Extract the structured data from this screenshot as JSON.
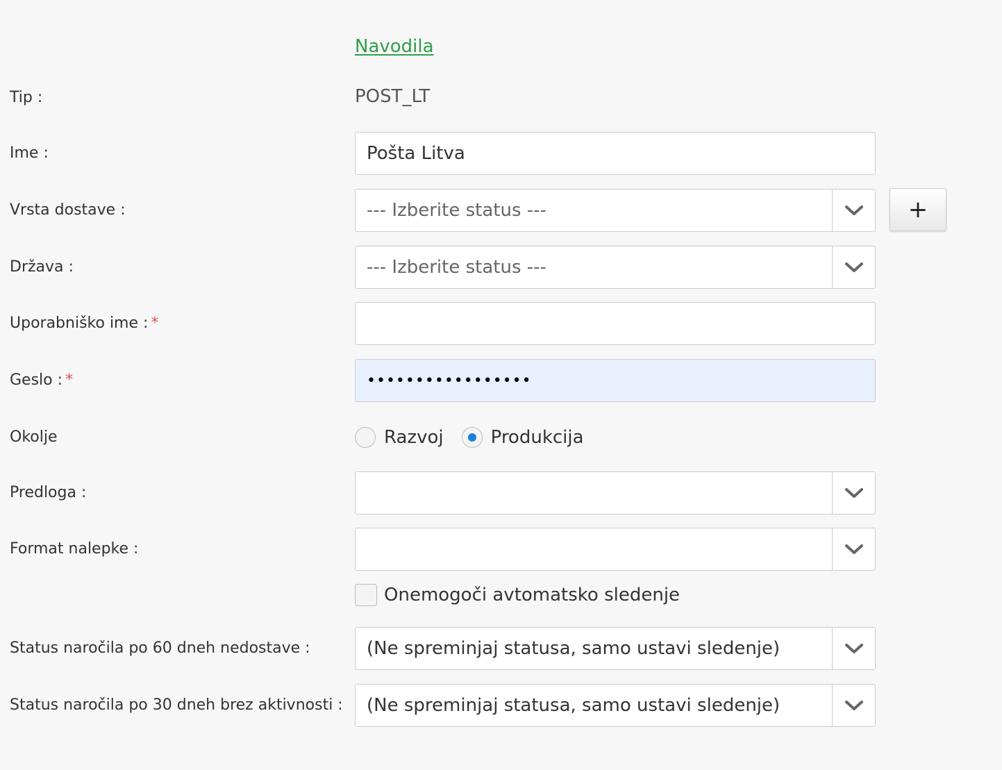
{
  "instructions_link": "Navodila",
  "fields": {
    "tip": {
      "label": "Tip :",
      "value": "POST_LT"
    },
    "ime": {
      "label": "Ime :",
      "value": "Pošta Litva"
    },
    "vrsta_dostave": {
      "label": "Vrsta dostave :",
      "value": "--- Izberite status ---",
      "add_label": "+"
    },
    "drzava": {
      "label": "Država :",
      "value": "--- Izberite status ---"
    },
    "uporabnisko_ime": {
      "label": "Uporabniško ime :",
      "required_mark": "*",
      "value": ""
    },
    "geslo": {
      "label": "Geslo :",
      "required_mark": "*",
      "value": "•••••••••••••••••"
    },
    "okolje": {
      "label": "Okolje",
      "options": [
        {
          "label": "Razvoj",
          "selected": false
        },
        {
          "label": "Produkcija",
          "selected": true
        }
      ]
    },
    "predloga": {
      "label": "Predloga :",
      "value": ""
    },
    "format_nalepke": {
      "label": "Format nalepke :",
      "value": ""
    },
    "disable_tracking": {
      "label": "Onemogoči avtomatsko sledenje",
      "checked": false
    },
    "status_60": {
      "label": "Status naročila po 60 dneh nedostave :",
      "value": "(Ne spreminjaj statusa, samo ustavi sledenje)"
    },
    "status_30": {
      "label": "Status naročila po 30 dneh brez aktivnosti :",
      "value": "(Ne spreminjaj statusa, samo ustavi sledenje)"
    }
  },
  "colors": {
    "link": "#2e9e4a",
    "required": "#d9534f",
    "radio_selected": "#1e7ee0",
    "password_bg": "#e8f0fe"
  },
  "icons": {
    "select_arrow": "chevron-down-icon",
    "add": "plus-icon"
  }
}
